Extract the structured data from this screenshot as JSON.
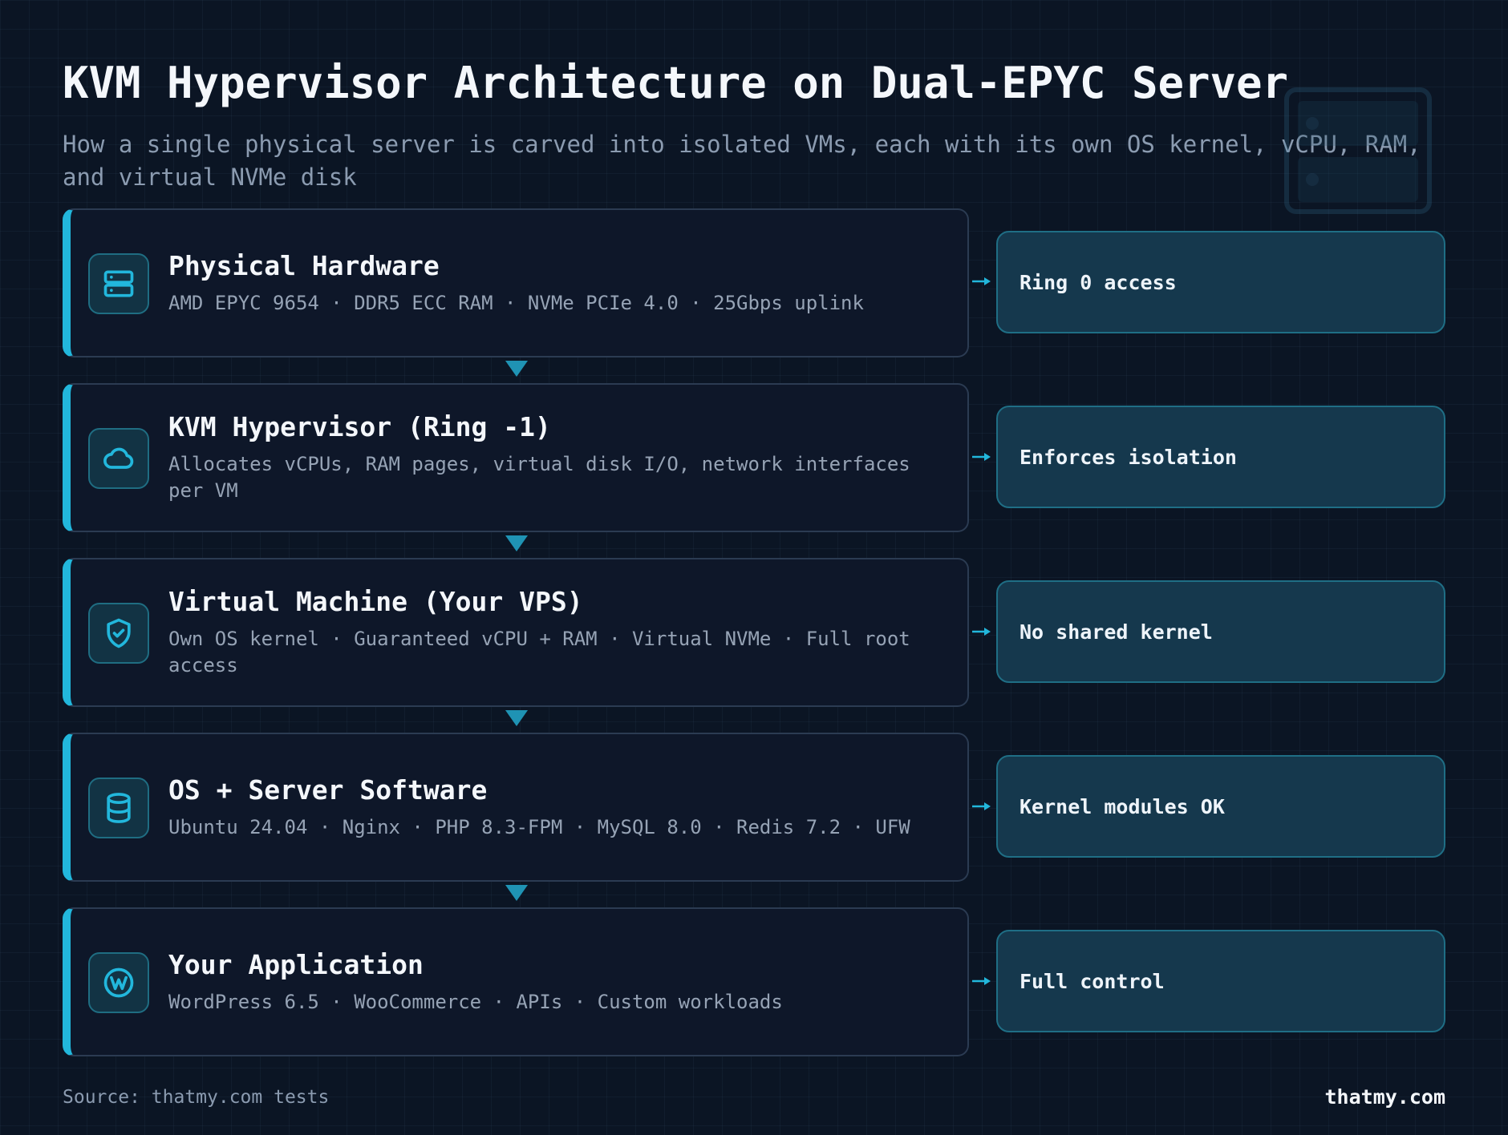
{
  "header": {
    "title": "KVM Hypervisor Architecture on Dual-EPYC Server",
    "subtitle": "How a single physical server is carved into isolated VMs, each with its own OS kernel, vCPU, RAM, and virtual NVMe disk"
  },
  "layers": [
    {
      "title": "Physical Hardware",
      "description": "AMD EPYC 9654 · DDR5 ECC RAM · NVMe PCIe 4.0 · 25Gbps uplink",
      "icon": "server-icon",
      "side_label": "Ring 0 access"
    },
    {
      "title": "KVM Hypervisor (Ring -1)",
      "description": "Allocates vCPUs, RAM pages, virtual disk I/O, network interfaces per VM",
      "icon": "cloud-icon",
      "side_label": "Enforces isolation"
    },
    {
      "title": "Virtual Machine (Your VPS)",
      "description": "Own OS kernel · Guaranteed vCPU + RAM · Virtual NVMe · Full root access",
      "icon": "shield-check-icon",
      "side_label": "No shared kernel"
    },
    {
      "title": "OS + Server Software",
      "description": "Ubuntu 24.04 · Nginx · PHP 8.3-FPM · MySQL 8.0 · Redis 7.2 · UFW",
      "icon": "database-icon",
      "side_label": "Kernel modules OK"
    },
    {
      "title": "Your Application",
      "description": "WordPress 6.5 · WooCommerce · APIs · Custom workloads",
      "icon": "wordpress-icon",
      "side_label": "Full control"
    }
  ],
  "footer": {
    "source": "Source: thatmy.com tests",
    "brand": "thatmy.com"
  },
  "colors": {
    "background": "#0b1524",
    "card_background": "#0e1729",
    "accent": "#22b7dc",
    "side_card_background": "#15384d"
  }
}
